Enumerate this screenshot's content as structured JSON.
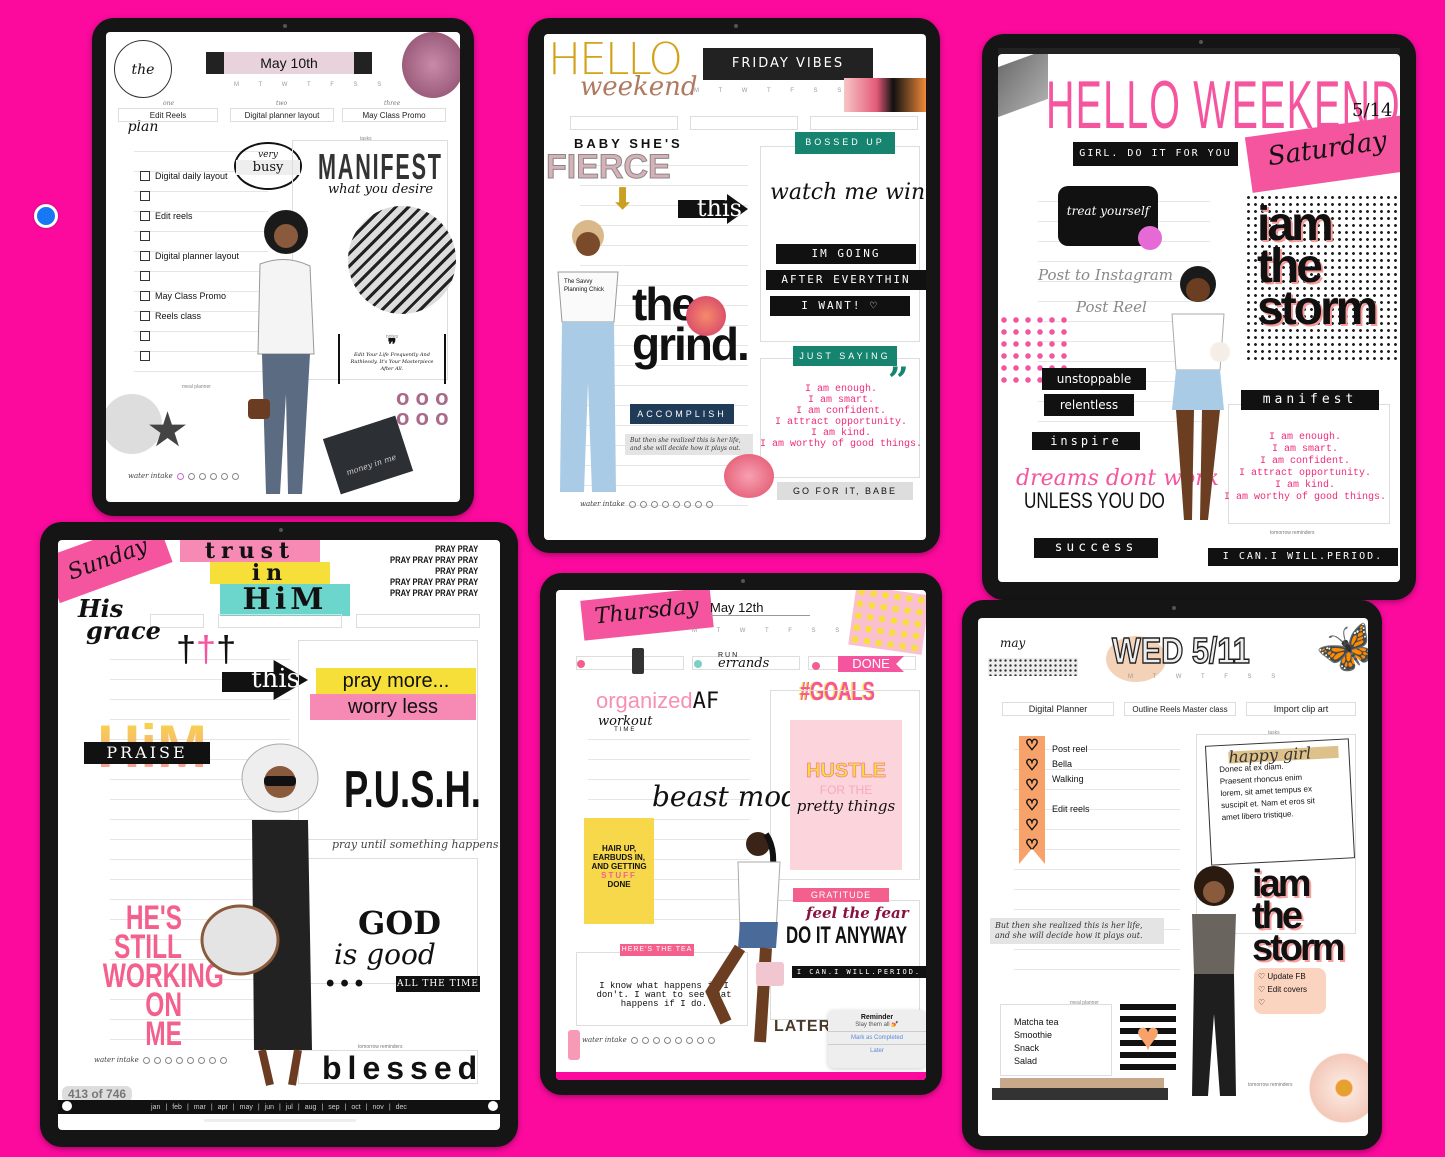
{
  "colors": {
    "background": "#fb0a9d",
    "accent_pink": "#ee2a7b",
    "green": "#17846f",
    "navy": "#1f3b57",
    "gold": "#d4a21a",
    "peach": "#f7a26a"
  },
  "cursor": {
    "icon": "blue-dot-icon"
  },
  "p1": {
    "logo": "the plan",
    "date": "May 10th",
    "weekdays": "M T W T F S S",
    "priority_labels": [
      "one",
      "two",
      "three"
    ],
    "priorities": [
      "Edit Reels",
      "Digital planner layout",
      "May Class Promo"
    ],
    "checklist": [
      "Digital daily layout",
      "",
      "Edit reels",
      "",
      "Digital planner layout",
      "",
      "May Class Promo",
      "Reels class",
      "",
      ""
    ],
    "bubble_top": "very",
    "bubble": "busy",
    "manifest": "MANIFEST",
    "manifest_sub": "what you desire",
    "tasks_label": "tasks",
    "notes_label": "notes",
    "quote": "Edit Your Life Frequently And Ruthlessly. It's Your Masterpiece After All.",
    "meal_label": "meal planner",
    "water": "water intake",
    "envelope": "money in me"
  },
  "p2": {
    "hello": "HELLO",
    "weekend": "weekend",
    "banner": "FRIDAY VIBES",
    "weekdays": "M T W T F S S",
    "babyshes": "BABY SHE'S",
    "fierce": "FIERCE",
    "this": "this",
    "bossed": "BOSSED UP",
    "watch": "watch me win",
    "strips": [
      "IM GOING",
      "AFTER EVERYTHIN",
      "I WANT! ♡"
    ],
    "shirt": "The Savvy Planning Chick",
    "grind1": "the",
    "grind2": "grind.",
    "just": "JUST SAYING",
    "affirmations": [
      "I am enough.",
      "I am smart.",
      "I am confident.",
      "I attract opportunity.",
      "I am kind.",
      "I am worthy of good things."
    ],
    "accomplish": "ACCOMPLISH",
    "quote": "But then she realized this is her life, and she will decide how it plays out.",
    "gofor": "GO FOR IT, BABE",
    "water": "water intake"
  },
  "p3": {
    "title": "HELLO WEEKEND",
    "date": "5/14",
    "banner": "GIRL. DO IT FOR YOU",
    "day": "Saturday",
    "bag": "treat yourself",
    "post1": "Post to Instagram",
    "post2": "Post Reel",
    "storm": [
      "iam",
      "the",
      "storm"
    ],
    "words": [
      "unstoppable",
      "relentless",
      "inspire"
    ],
    "dreams": "dreams dont work",
    "unless": "UNLESS YOU DO",
    "success": "success",
    "manifest": "manifest",
    "affirmations": [
      "I am enough.",
      "I am smart.",
      "I am confident.",
      "I attract opportunity.",
      "I am kind.",
      "I am worthy of good things."
    ],
    "reminders": "tomorrow reminders",
    "period": "I CAN.I WILL.PERIOD."
  },
  "p4": {
    "day": "Sunday",
    "trust": [
      "trust",
      "in",
      "HiM"
    ],
    "pray": [
      "PRAY PRAY",
      "PRAY PRAY PRAY PRAY",
      "PRAY PRAY",
      "PRAY PRAY PRAY PRAY",
      "PRAY PRAY PRAY PRAY"
    ],
    "grace1": "His",
    "grace2": "grace",
    "this": "this",
    "praymore": "pray more...",
    "worryless": "worry less",
    "him": "HiM",
    "praise": "PRAISE",
    "push": "P.U.S.H.",
    "push_sub": "pray until something happens",
    "hes": [
      "HE'S",
      "STILL",
      "WORKING",
      "ON ME"
    ],
    "god": "GOD",
    "isgood": "is good",
    "alltime": "ALL THE TIME",
    "water": "water intake",
    "reminders": "tomorrow reminders",
    "blessed": "blessed",
    "page_counter": "413 of 746",
    "months": [
      "jan",
      "feb",
      "mar",
      "apr",
      "may",
      "jun",
      "jul",
      "aug",
      "sep",
      "oct",
      "nov",
      "dec"
    ]
  },
  "p5": {
    "day": "Thursday",
    "date": "May 12th",
    "weekdays": "M T W T F S S",
    "run": "RUN",
    "errands": "errands",
    "done": "DONE",
    "goals": "#GOALS",
    "organized": "organized",
    "af": "AF",
    "workout": "workout",
    "time": "TIME",
    "beast": "beast mode",
    "hustle": "HUSTLE",
    "forthe": "FOR THE",
    "pretty": "pretty things",
    "hair": [
      "HAIR UP,",
      "EARBUDS IN,",
      "AND GETTING",
      "STUFF",
      "DONE"
    ],
    "gratitude": "GRATITUDE",
    "feel": "feel the fear",
    "doit": "DO IT ANYWAY",
    "period": "I CAN.I WILL.PERIOD.",
    "tea": "HERE'S THE TEA",
    "quote": "I know what happens if I don't. I want to see what happens if I do.",
    "water": "water intake",
    "later": "LATER",
    "reminder": {
      "title": "Reminder",
      "body": "Slay them all 💅",
      "complete": "Mark as Completed",
      "later": "Later"
    }
  },
  "p6": {
    "month": "may",
    "date": "WED 5/11",
    "weekdays": "M T W T F S S",
    "priorities": [
      "Digital Planner",
      "Outline Reels Master class",
      "Import clip art"
    ],
    "list": [
      "Post reel",
      "Bella",
      "Walking",
      "Edit reels"
    ],
    "tasks_label": "tasks",
    "happy": "happy girl",
    "note": [
      "Donec at ex diam.",
      "Praesent rhoncus enim",
      "lorem, sit amet tempus ex",
      "suscipit et. Nam et eros sit",
      "amet libero tristique."
    ],
    "storm": [
      "iam",
      "the",
      "storm"
    ],
    "todo": [
      "Update FB",
      "Edit covers",
      ""
    ],
    "quote": "But then she realized this is her life, and she will decide how it plays out.",
    "meal_label": "meal planner",
    "meals": [
      "Matcha tea",
      "Smoothie",
      "Snack",
      "Salad"
    ],
    "reminders": "tomorrow reminders"
  }
}
